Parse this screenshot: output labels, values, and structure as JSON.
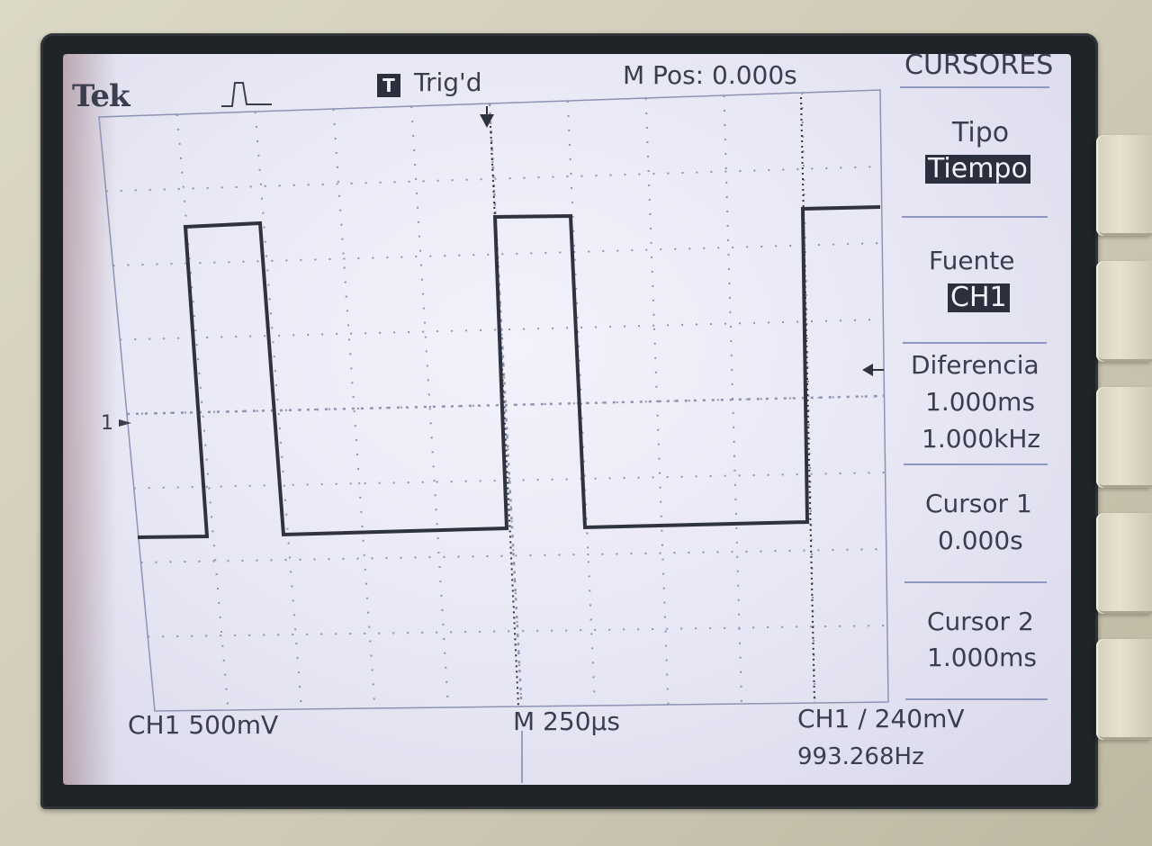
{
  "header": {
    "brand": "Tek",
    "trigger_badge": "T",
    "trigger_status": "Trig'd",
    "m_pos": "M Pos: 0.000s",
    "menu_title": "CURSORES"
  },
  "side_menu": {
    "tipo_label": "Tipo",
    "tipo_value": "Tiempo",
    "fuente_label": "Fuente",
    "fuente_value": "CH1",
    "diferencia_label": "Diferencia",
    "diferencia_time": "1.000ms",
    "diferencia_freq": "1.000kHz",
    "cursor1_label": "Cursor 1",
    "cursor1_value": "0.000s",
    "cursor2_label": "Cursor 2",
    "cursor2_value": "1.000ms"
  },
  "waveform": {
    "channel_marker": "1",
    "trace_color": "#2f3340",
    "grid_color": "#8d93b5"
  },
  "footer": {
    "ch1_scale": "CH1  500mV",
    "timebase": "M 250µs",
    "trigger_setting": "CH1 ∕ 240mV",
    "frequency": "993.268Hz"
  }
}
